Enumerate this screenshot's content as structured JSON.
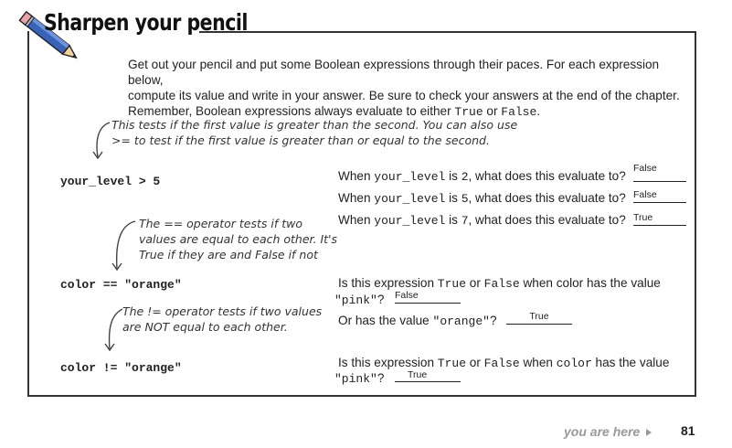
{
  "header": {
    "title": "Sharpen your pencil"
  },
  "intro": {
    "line1": "Get out your pencil and put some Boolean expressions through their paces. For each expression below,",
    "line2": "compute its value and write in your answer. Be sure to check your answers at the end of the chapter.",
    "line3_pre": "Remember, Boolean expressions always evaluate to either ",
    "true_word": "True",
    "or_word": " or ",
    "false_word": "False",
    "period": "."
  },
  "notes": {
    "gt_line1": "This tests if the first value is greater than the second. You can also use",
    "gt_line2": ">= to test if the first value is greater than or equal to the second.",
    "eq_line1": "The == operator tests if two",
    "eq_line2": "values are equal to each other. It's",
    "eq_line3": "True if they are and False if not",
    "neq_line1": "The != operator tests if two values",
    "neq_line2": "are NOT equal to each other."
  },
  "expressions": {
    "level": "your_level > 5",
    "eq": "color == \"orange\"",
    "neq": "color != \"orange\""
  },
  "questions": {
    "when": "When ",
    "var_level": "your_level",
    "is_word": " is ",
    "val2": "2",
    "val5": "5",
    "val7": "7",
    "eval_suffix": ", what does this evaluate to?",
    "is_expr": "Is this expression ",
    "true_word": "True",
    "or_word": " or ",
    "false_word": "False",
    "when_color": " when color has the value",
    "when_word": " when ",
    "color_var": "color",
    "has_value": " has the value",
    "pink": "\"pink\"",
    "q_mark": "?",
    "or_has": "Or has the value ",
    "orange": "\"orange\""
  },
  "answers": {
    "a_level2": "False",
    "a_level5": "False",
    "a_level7": "True",
    "a_eq_pink": "False",
    "a_eq_orange": "True",
    "a_neq_pink": "True"
  },
  "footer": {
    "you_are_here": "you are here",
    "page_number": "81"
  }
}
